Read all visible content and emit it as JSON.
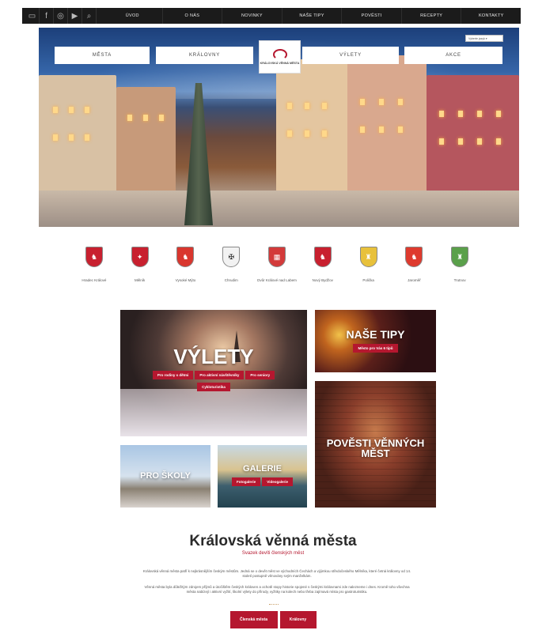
{
  "topbar": {
    "icons": [
      "chat-icon",
      "facebook-icon",
      "instagram-icon",
      "youtube-icon",
      "search-icon"
    ],
    "menu": [
      "ÚVOD",
      "O NÁS",
      "NOVINKY",
      "NAŠE TIPY",
      "POVĚSTI",
      "RECEPTY",
      "KONTAKTY"
    ]
  },
  "hero": {
    "nav_left": [
      "MĚSTA",
      "KRÁLOVNY"
    ],
    "nav_right": [
      "VÝLETY",
      "AKCE"
    ],
    "logo_text": "KRÁLOVSKÁ VĚNNÁ MĚSTA",
    "translate_label": "Vyberte jazyk"
  },
  "crests": [
    {
      "name": "Hradec Králové",
      "color": "#c8202f",
      "glyph": "♞"
    },
    {
      "name": "Mělník",
      "color": "#c8202f",
      "glyph": "✦"
    },
    {
      "name": "Vysoké Mýto",
      "color": "#d9362e",
      "glyph": "♞"
    },
    {
      "name": "Chrudim",
      "color": "#f2f2f2",
      "glyph": "✠"
    },
    {
      "name": "Dvůr Králové nad Labem",
      "color": "#d33a3a",
      "glyph": "▦"
    },
    {
      "name": "Nový Bydžov",
      "color": "#c8202f",
      "glyph": "♞"
    },
    {
      "name": "Polička",
      "color": "#e8c13b",
      "glyph": "♜"
    },
    {
      "name": "Jaroměř",
      "color": "#de3a2e",
      "glyph": "♞"
    },
    {
      "name": "Trutnov",
      "color": "#5aa04a",
      "glyph": "♜"
    }
  ],
  "tiles": {
    "vylety": {
      "title": "VÝLETY",
      "buttons": [
        "Pro rodiny s dětmi",
        "Pro aktivní návštěvníky",
        "Pro seniory",
        "Cykloturistika"
      ]
    },
    "tipy": {
      "title": "NAŠE TIPY",
      "buttons": [
        "Město pro Vás 6 tipů"
      ]
    },
    "povesti": {
      "title": "POVĚSTI VĚNNÝCH MĚST"
    },
    "skoly": {
      "title": "PRO ŠKOLY"
    },
    "galerie": {
      "title": "GALERIE",
      "buttons": [
        "Fotogalerie",
        "Videogalerie"
      ]
    }
  },
  "bottom": {
    "title": "Královská věnná města",
    "subtitle": "Svazek devíti členských měst",
    "para1": "Královská věnná města patří k nejkrásnějším českým městům. Jedná se o devět měst ve východních Čechách a výjimkou středočeského Mělníka, které četná královny od 14. století postupně věnovány svým manželkám.",
    "para2": "Věnná města byla důležitým zdrojem příjmů a útočištěm českých královen a ochotě stopy historie spojené s českými královnami zde nalezneme i dnes. Kromě toho všechna města nabízejí i aktivní vyžití, školní výlety do přírody, vyžitky na kolech nebo třeba zajímavá místa pro gastroturistiku.",
    "buttons": [
      "Členská města",
      "Královny"
    ]
  }
}
